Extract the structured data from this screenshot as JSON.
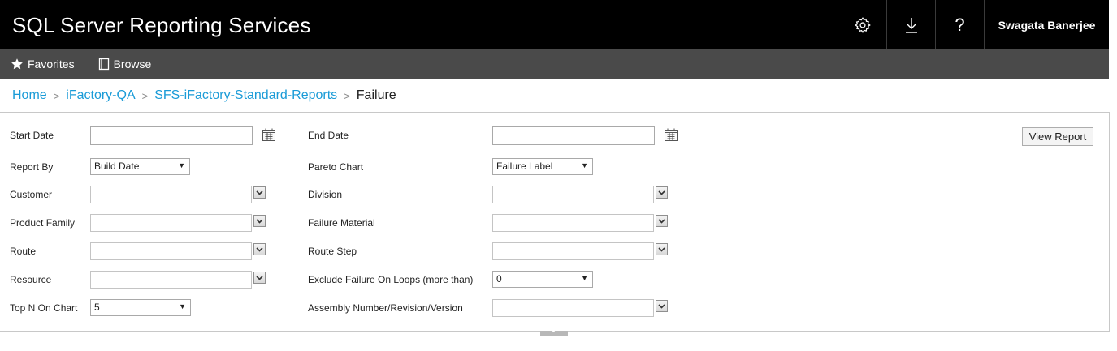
{
  "header": {
    "app_title": "SQL Server Reporting Services",
    "settings_icon": "gear-icon",
    "download_icon": "download-icon",
    "help_label": "?",
    "user_name": "Swagata Banerjee"
  },
  "nav": {
    "favorites": "Favorites",
    "browse": "Browse"
  },
  "breadcrumb": {
    "home": "Home",
    "folder1": "iFactory-QA",
    "folder2": "SFS-iFactory-Standard-Reports",
    "current": "Failure",
    "separator": ">"
  },
  "params": {
    "start_date": {
      "label": "Start Date",
      "value": ""
    },
    "end_date": {
      "label": "End Date",
      "value": ""
    },
    "report_by": {
      "label": "Report By",
      "value": "Build Date"
    },
    "pareto_chart": {
      "label": "Pareto Chart",
      "value": "Failure Label"
    },
    "customer": {
      "label": "Customer",
      "value": ""
    },
    "division": {
      "label": "Division",
      "value": ""
    },
    "product_family": {
      "label": "Product Family",
      "value": ""
    },
    "failure_material": {
      "label": "Failure Material",
      "value": ""
    },
    "route": {
      "label": "Route",
      "value": ""
    },
    "route_step": {
      "label": "Route Step",
      "value": ""
    },
    "resource": {
      "label": "Resource",
      "value": ""
    },
    "exclude_loops": {
      "label": "Exclude Failure On Loops (more than)",
      "value": "0"
    },
    "top_n": {
      "label": "Top N On Chart",
      "value": "5"
    },
    "assembly": {
      "label": "Assembly Number/Revision/Version",
      "value": ""
    }
  },
  "actions": {
    "view_report": "View Report"
  },
  "colors": {
    "header_bg": "#000000",
    "nav_bg": "#4a4a4a",
    "link": "#1a9bd7"
  }
}
